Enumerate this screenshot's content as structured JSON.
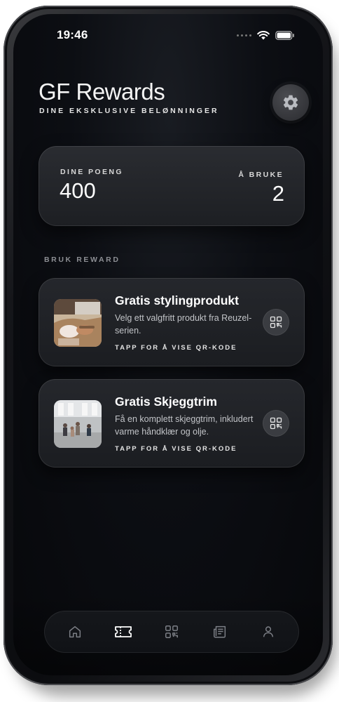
{
  "status_bar": {
    "time": "19:46"
  },
  "header": {
    "title": "GF Rewards",
    "subtitle": "DINE EKSKLUSIVE BELØNNINGER"
  },
  "points": {
    "points_label": "DINE POENG",
    "points_value": "400",
    "use_label": "Å BRUKE",
    "use_value": "2"
  },
  "section_label": "BRUK REWARD",
  "rewards": [
    {
      "title": "Gratis stylingprodukt",
      "description": "Velg ett valgfritt produkt fra Reuzel-serien.",
      "cta": "TAPP FOR Å VISE QR-KODE"
    },
    {
      "title": "Gratis Skjeggtrim",
      "description": "Få en komplett skjeggtrim, inkludert varme håndklær og olje.",
      "cta": "TAPP FOR Å VISE QR-KODE"
    }
  ],
  "tabbar": {
    "tabs": [
      {
        "icon": "home-icon",
        "active": false
      },
      {
        "icon": "ticket-icon",
        "active": true
      },
      {
        "icon": "qr-code-icon",
        "active": false
      },
      {
        "icon": "newspaper-icon",
        "active": false
      },
      {
        "icon": "user-icon",
        "active": false
      }
    ]
  },
  "colors": {
    "background": "#0c0e13",
    "card": "#25272c",
    "text": "#ffffff",
    "muted": "#8d8f94",
    "icon_inactive": "#7c7f86",
    "icon_active": "#ffffff"
  }
}
